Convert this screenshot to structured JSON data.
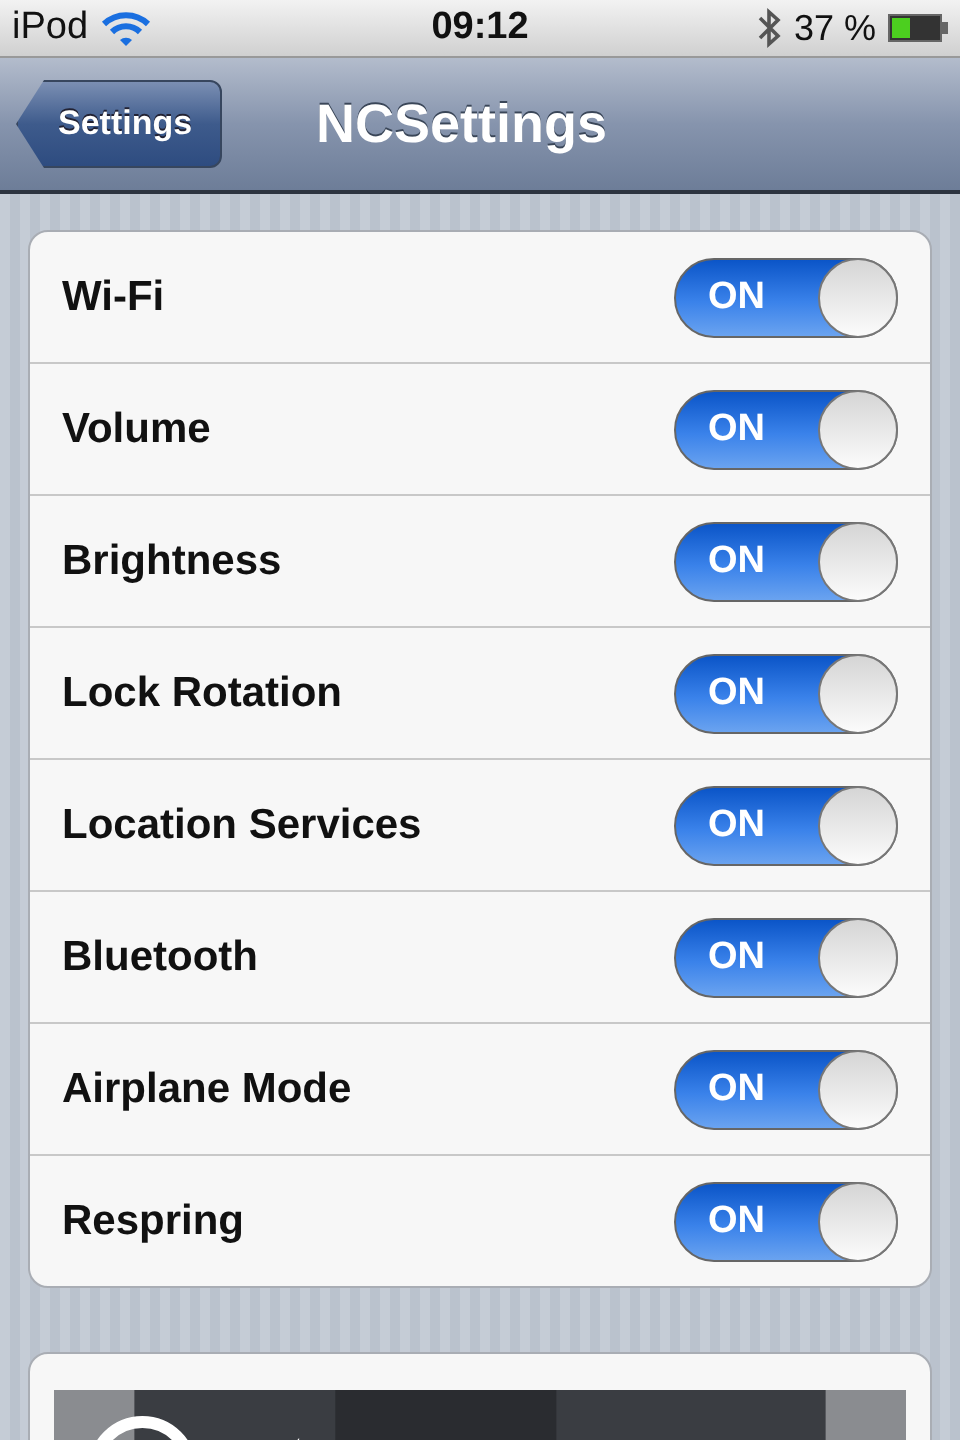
{
  "status_bar": {
    "carrier": "iPod",
    "time": "09:12",
    "battery": "37 %"
  },
  "nav_bar": {
    "back": "Settings",
    "title": "NCSettings"
  },
  "settings": [
    {
      "label": "Wi-Fi",
      "switch_text": "ON",
      "on": true
    },
    {
      "label": "Volume",
      "switch_text": "ON",
      "on": true
    },
    {
      "label": "Brightness",
      "switch_text": "ON",
      "on": true
    },
    {
      "label": "Lock Rotation",
      "switch_text": "ON",
      "on": true
    },
    {
      "label": "Location Services",
      "switch_text": "ON",
      "on": true
    },
    {
      "label": "Bluetooth",
      "switch_text": "ON",
      "on": true
    },
    {
      "label": "Airplane Mode",
      "switch_text": "ON",
      "on": true
    },
    {
      "label": "Respring",
      "switch_text": "ON",
      "on": true
    }
  ]
}
